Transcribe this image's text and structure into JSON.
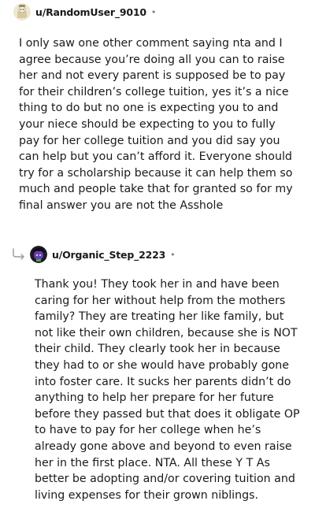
{
  "comments": [
    {
      "username": "u/RandomUser_9010",
      "separator": "•",
      "avatar_icon": "snoo-avatar-icon",
      "text": "I only saw one other comment saying nta and I agree because you’re doing all you can to raise her and not every parent is supposed be to pay for their children’s college tuition, yes it’s a nice thing to do but no one is expecting you to and your niece should be expecting to you to fully pay for her college tuition and you did say you can help but you can’t afford it. Everyone should try for a scholarship because it can help them so much and people take that for granted so for my final answer you are not the Asshole"
    },
    {
      "username": "u/Organic_Step_2223",
      "separator": "•",
      "avatar_icon": "snoo-avatar-icon",
      "reply_icon": "reply-arrow-icon",
      "text": "Thank you! They took her in and have been caring for her without help from the mothers family? They are treating her like family, but not like their own children, because she is NOT their child. They clearly took her in because they had to or she would have probably gone into foster care. It sucks her parents didn’t do anything to help her prepare for her future before they passed but that does it obligate OP to have to pay for her college when he’s already gone above and beyond to even raise her in the first place. NTA. All these Y T As better be adopting and/or covering tuition and living expenses for their grown niblings."
    }
  ],
  "colors": {
    "text": "#1a1a1b",
    "meta": "#7c7c7c",
    "avatar1_bg": "#e8dfc8",
    "avatar2_bg": "#1c1a22"
  }
}
